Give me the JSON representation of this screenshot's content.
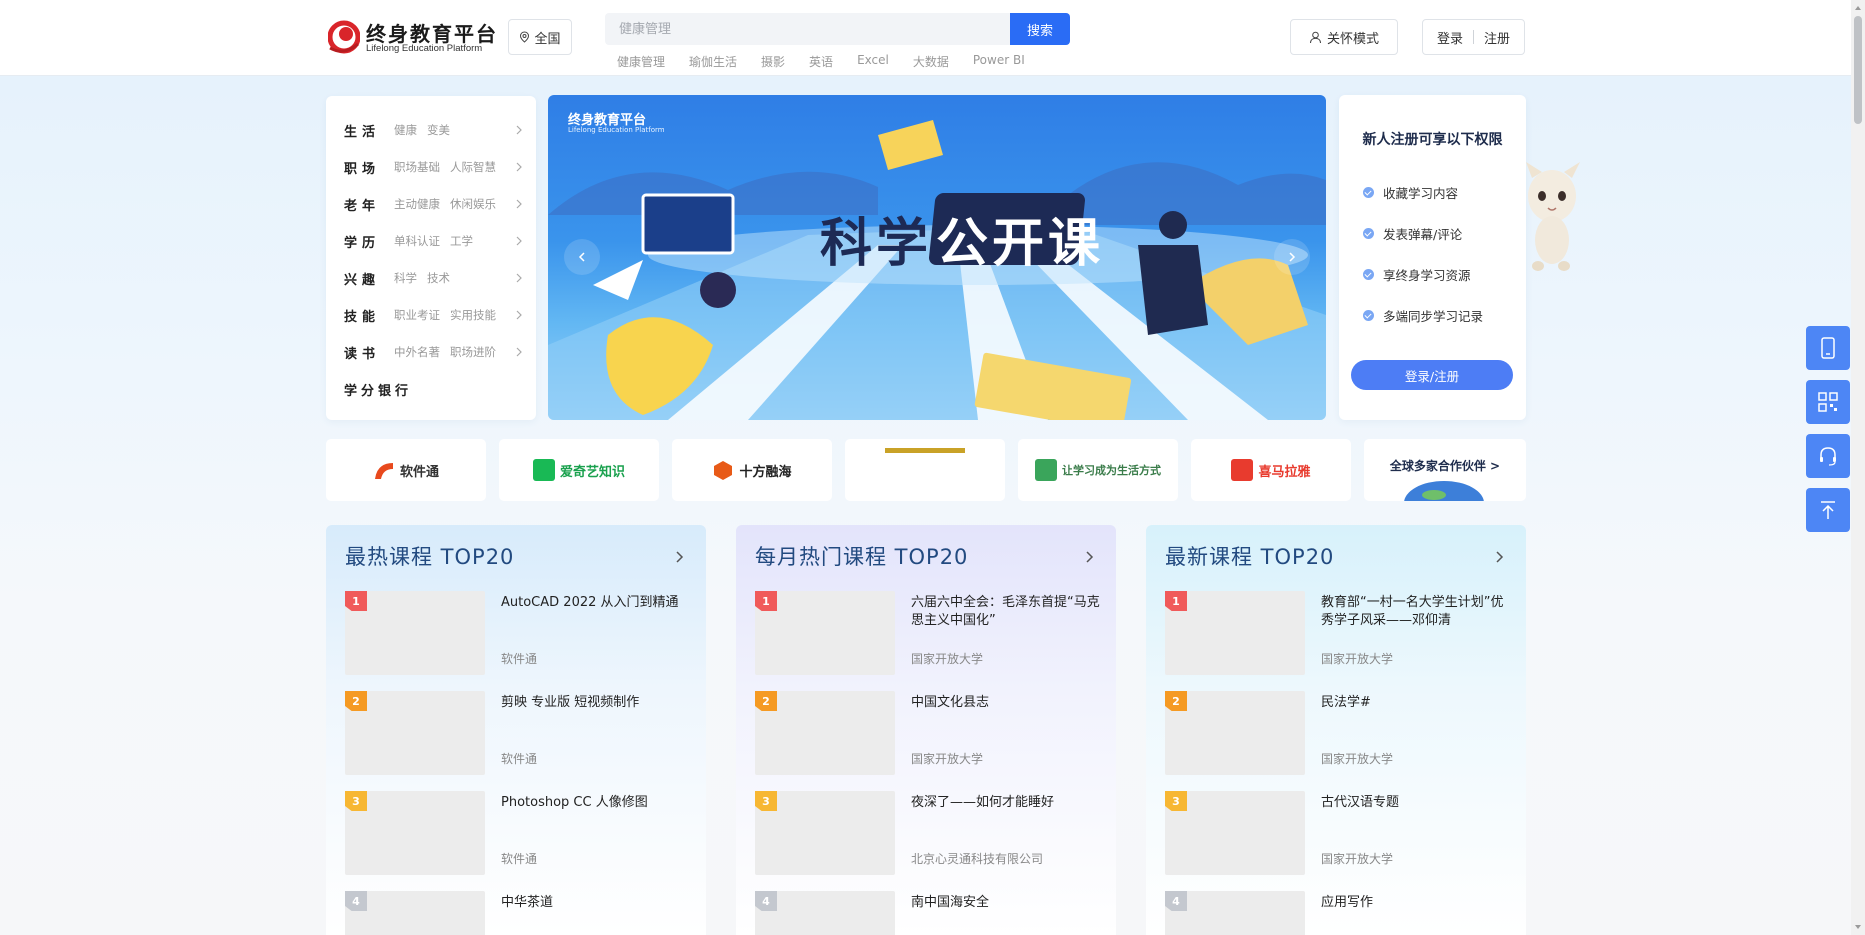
{
  "header": {
    "logo_title": "终身教育平台",
    "logo_sub": "Lifelong Education Platform",
    "region": "全国",
    "search_placeholder": "健康管理",
    "search_button": "搜索",
    "hot_words": [
      "健康管理",
      "瑜伽生活",
      "摄影",
      "英语",
      "Excel",
      "大数据",
      "Power BI"
    ],
    "care_mode": "关怀模式",
    "login": "登录",
    "register": "注册"
  },
  "categories": [
    {
      "name": "生活",
      "subs": [
        "健康",
        "变美"
      ]
    },
    {
      "name": "职场",
      "subs": [
        "职场基础",
        "人际智慧"
      ]
    },
    {
      "name": "老年",
      "subs": [
        "主动健康",
        "休闲娱乐"
      ]
    },
    {
      "name": "学历",
      "subs": [
        "单科认证",
        "工学"
      ]
    },
    {
      "name": "兴趣",
      "subs": [
        "科学",
        "技术"
      ]
    },
    {
      "name": "技能",
      "subs": [
        "职业考证",
        "实用技能"
      ]
    },
    {
      "name": "读书",
      "subs": [
        "中外名著",
        "职场进阶"
      ]
    },
    {
      "name": "学分银行",
      "subs": []
    }
  ],
  "banner": {
    "logo": "终身教育平台",
    "logo_sub": "Lifelong Education Platform",
    "title_a": "科学",
    "title_b": "公开课"
  },
  "perks": {
    "title": "新人注册可享以下权限",
    "items": [
      "收藏学习内容",
      "发表弹幕/评论",
      "享终身学习资源",
      "多端同步学习记录"
    ],
    "button": "登录/注册"
  },
  "partners": [
    {
      "name": "软件通",
      "color": "#e8491d"
    },
    {
      "name": "爱奇艺知识",
      "color": "#19b955"
    },
    {
      "name": "十方融海",
      "color": "#e85a17"
    },
    {
      "name": "",
      "color": "#c9a227"
    },
    {
      "name": "让学习成为生活方式",
      "color": "#3aa55b"
    },
    {
      "name": "喜马拉雅",
      "color": "#e83b2e"
    },
    {
      "name": "全球多家合作伙伴 >",
      "color": "#1f2d4d"
    }
  ],
  "columns": [
    {
      "title": "最热课程 TOP20",
      "courses": [
        {
          "rank": "1",
          "title": "AutoCAD 2022 从入门到精通",
          "org": "软件通"
        },
        {
          "rank": "2",
          "title": "剪映 专业版 短视频制作",
          "org": "软件通"
        },
        {
          "rank": "3",
          "title": "Photoshop CC 人像修图",
          "org": "软件通"
        },
        {
          "rank": "4",
          "title": "中华茶道",
          "org": ""
        }
      ]
    },
    {
      "title": "每月热门课程 TOP20",
      "courses": [
        {
          "rank": "1",
          "title": "六届六中全会：毛泽东首提“马克思主义中国化”",
          "org": "国家开放大学"
        },
        {
          "rank": "2",
          "title": "中国文化县志",
          "org": "国家开放大学"
        },
        {
          "rank": "3",
          "title": "夜深了——如何才能睡好",
          "org": "北京心灵通科技有限公司"
        },
        {
          "rank": "4",
          "title": "南中国海安全",
          "org": ""
        }
      ]
    },
    {
      "title": "最新课程 TOP20",
      "courses": [
        {
          "rank": "1",
          "title": "教育部“一村一名大学生计划”优秀学子风采——邓仰清",
          "org": "国家开放大学"
        },
        {
          "rank": "2",
          "title": "民法学#",
          "org": "国家开放大学"
        },
        {
          "rank": "3",
          "title": "古代汉语专题",
          "org": "国家开放大学"
        },
        {
          "rank": "4",
          "title": "应用写作",
          "org": ""
        }
      ]
    }
  ],
  "colors": {
    "primary": "#2a6cf5",
    "rank1": "#f05a5a",
    "rank2": "#f59a23",
    "rank3": "#f7b733",
    "rank4": "#c4c8cf"
  }
}
